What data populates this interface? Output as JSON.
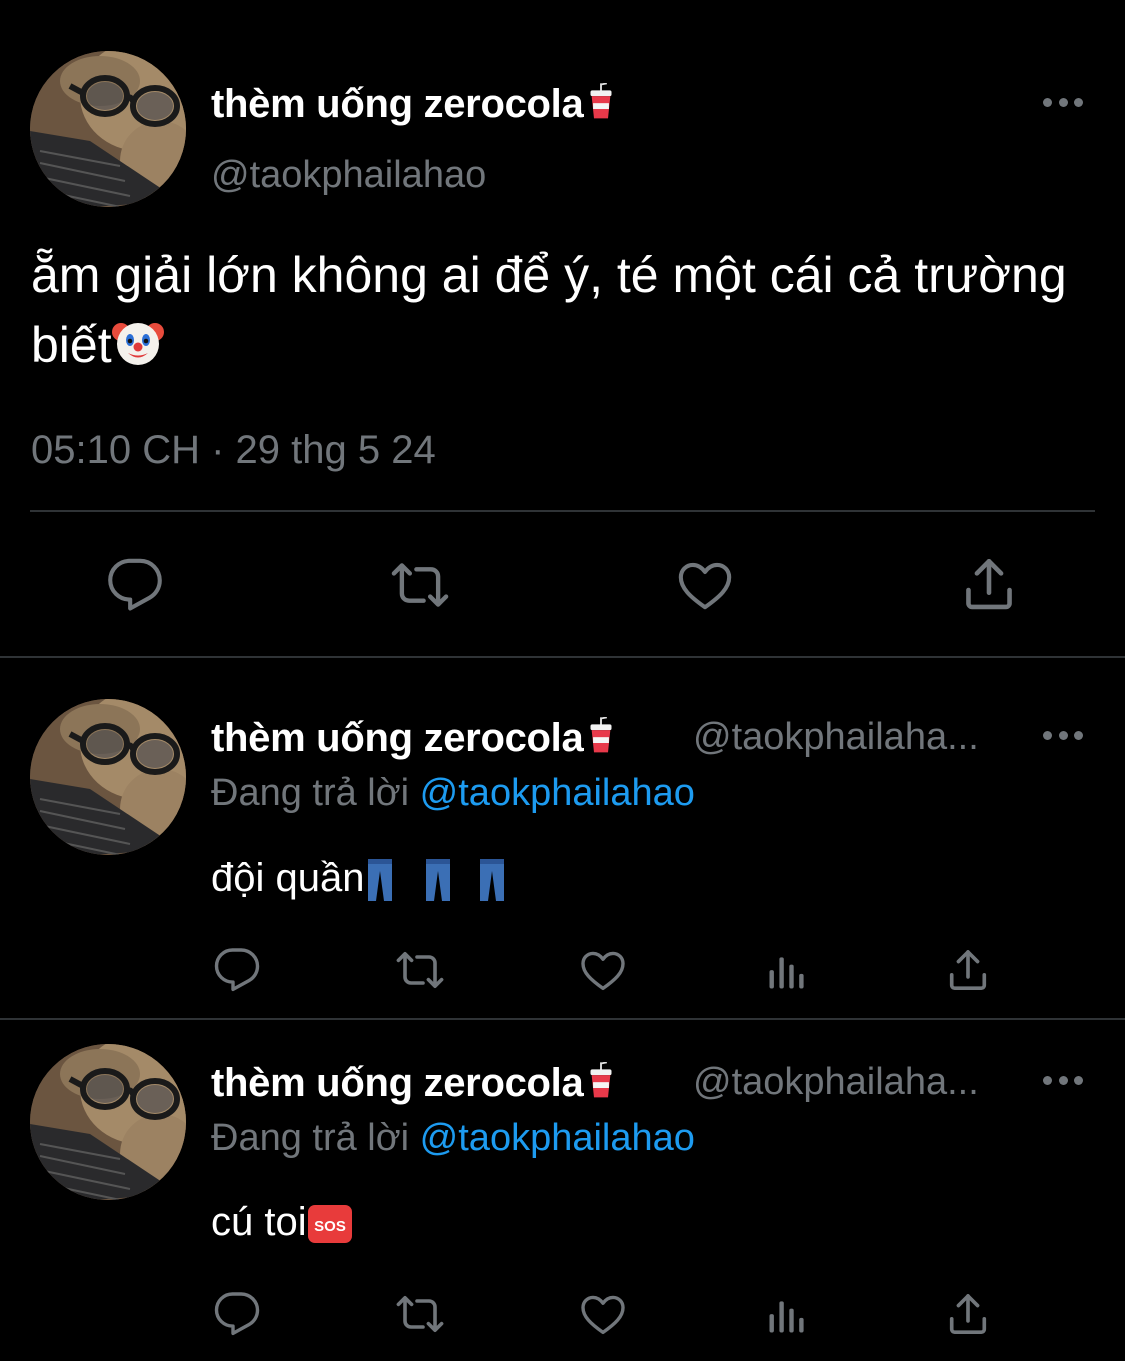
{
  "main_tweet": {
    "display_name": "thèm uống zerocola",
    "handle": "@taokphailahao",
    "text": "ẵm giải lớn không ai để ý, té một cái cả trường biết",
    "timestamp": "05:10 CH · 29 thg 5 24",
    "actions": [
      "reply-icon",
      "retweet-icon",
      "like-icon",
      "share-icon"
    ]
  },
  "replies": [
    {
      "display_name": "thèm uống zerocola",
      "handle": "@taokphailaha...",
      "replying_prefix": "Đang trả lời",
      "replying_to": "@taokphailahao",
      "text": "đội quần",
      "actions": [
        "reply-icon",
        "retweet-icon",
        "like-icon",
        "views-icon",
        "share-icon"
      ]
    },
    {
      "display_name": "thèm uống zerocola",
      "handle": "@taokphailaha...",
      "replying_prefix": "Đang trả lời",
      "replying_to": "@taokphailahao",
      "text": "cú toi",
      "emoji_label": "SOS",
      "actions": [
        "reply-icon",
        "retweet-icon",
        "like-icon",
        "views-icon",
        "share-icon"
      ]
    }
  ],
  "colors": {
    "background": "#000000",
    "text": "#ffffff",
    "secondary": "#71767b",
    "link": "#1d9bf0",
    "divider": "#2f3336"
  }
}
